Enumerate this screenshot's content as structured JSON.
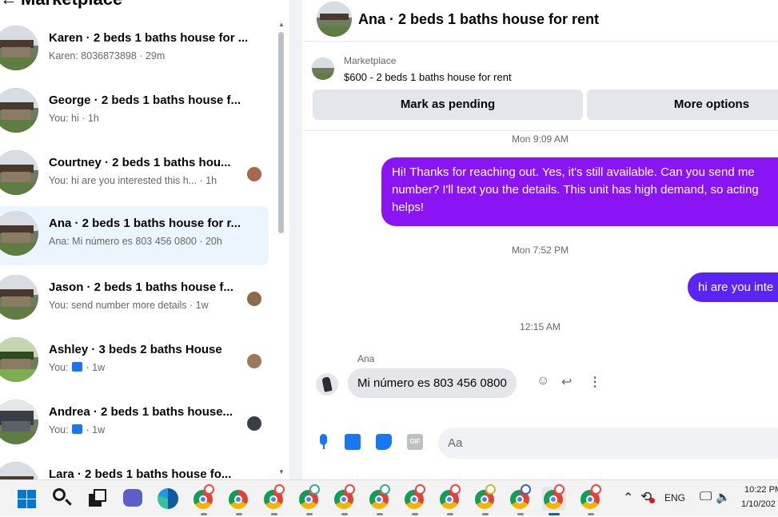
{
  "sidebar": {
    "title": "Marketplace",
    "conversations": [
      {
        "name": "Karen · 2 beds 1 baths house for ...",
        "preview": "Karen: 8036873898 · 29m"
      },
      {
        "name": "George · 2 beds 1 baths house f...",
        "preview": "You: hi · 1h"
      },
      {
        "name": "Courtney · 2 beds 1 baths hou...",
        "preview": "You: hi are you interested this h... · 1h"
      },
      {
        "name": "Ana · 2 beds 1 baths house for r...",
        "preview": "Ana: Mi número es 803 456 0800 · 20h"
      },
      {
        "name": "Jason · 2 beds 1 baths house f...",
        "preview": "You: send number more details · 1w"
      },
      {
        "name": "Ashley · 3 beds 2 baths House",
        "preview_prefix": "You:",
        "preview_suffix": "· 1w"
      },
      {
        "name": "Andrea · 2 beds 1 baths house...",
        "preview_prefix": "You:",
        "preview_suffix": "· 1w"
      },
      {
        "name": "Lara · 2 beds 1 baths house fo..."
      }
    ]
  },
  "chat": {
    "title": "Ana · 2 beds 1 baths house for rent",
    "listing_source": "Marketplace",
    "listing_price": "$600 - 2 beds 1 baths house for rent",
    "mark_pending_label": "Mark as pending",
    "more_options_label": "More options",
    "timestamps": [
      "Mon 9:09 AM",
      "Mon 7:52 PM",
      "12:15 AM"
    ],
    "messages": [
      {
        "text": "Hi! Thanks for reaching out. Yes, it's still available. Can you send me number? I'll text you the details. This unit has high demand, so acting helps!"
      },
      {
        "text": "hi are you inte"
      },
      {
        "sender": "Ana",
        "text": "Mi número es 803 456 0800"
      }
    ],
    "composer_placeholder": "Aa",
    "gif_label": "GIF"
  },
  "taskbar": {
    "language": "ENG",
    "time": "10:22 PM",
    "date": "1/10/202"
  },
  "colors": {
    "outgoing_bubble": "#8b14f5",
    "outgoing_bubble_2": "#5b24f4",
    "accent": "#1877f2",
    "active_conversation": "#ebf5ff"
  }
}
